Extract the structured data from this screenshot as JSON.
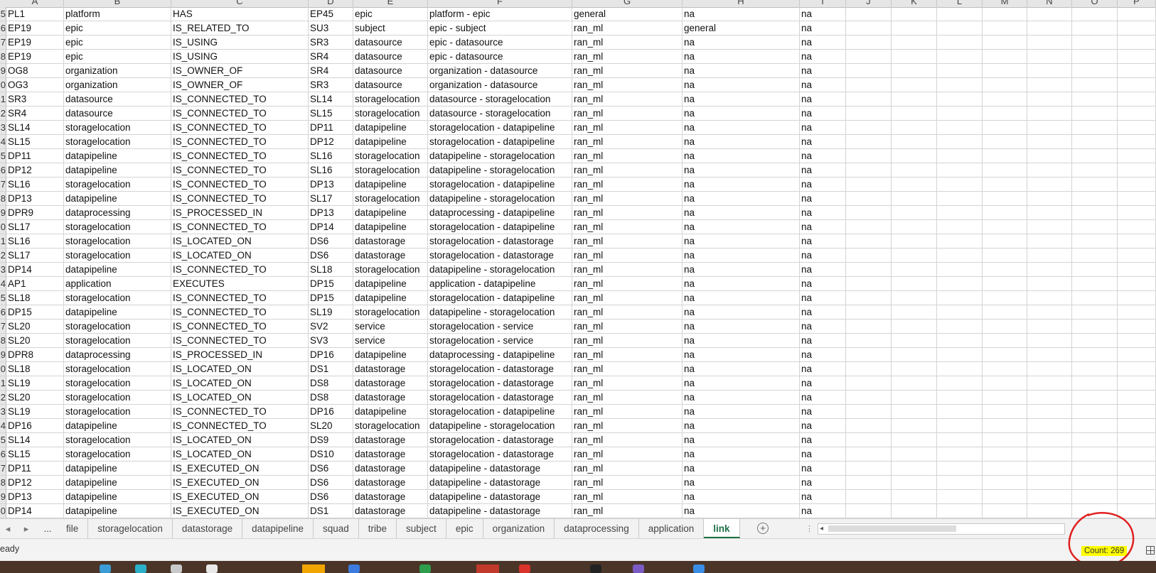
{
  "columns": [
    "A",
    "B",
    "C",
    "D",
    "E",
    "F",
    "G",
    "H",
    "I",
    "J",
    "K",
    "L",
    "M",
    "N",
    "O",
    "P"
  ],
  "row_number_labels": [
    "5",
    "6",
    "7",
    "8",
    "9",
    "0",
    "1",
    "2",
    "3",
    "4",
    "5",
    "6",
    "7",
    "8",
    "9",
    "0",
    "1",
    "2",
    "3",
    "4",
    "5",
    "6",
    "7",
    "8",
    "9",
    "0",
    "1",
    "2",
    "3",
    "4",
    "5",
    "6",
    "7",
    "8",
    "9",
    "0"
  ],
  "rows": [
    [
      "PL1",
      "platform",
      "HAS",
      "EP45",
      "epic",
      "platform - epic",
      "general",
      "na",
      "na"
    ],
    [
      "EP19",
      "epic",
      "IS_RELATED_TO",
      "SU3",
      "subject",
      "epic - subject",
      "ran_ml",
      "general",
      "na"
    ],
    [
      "EP19",
      "epic",
      "IS_USING",
      "SR3",
      "datasource",
      "epic - datasource",
      "ran_ml",
      "na",
      "na"
    ],
    [
      "EP19",
      "epic",
      "IS_USING",
      "SR4",
      "datasource",
      "epic - datasource",
      "ran_ml",
      "na",
      "na"
    ],
    [
      "OG8",
      "organization",
      "IS_OWNER_OF",
      "SR4",
      "datasource",
      "organization - datasource",
      "ran_ml",
      "na",
      "na"
    ],
    [
      "OG3",
      "organization",
      "IS_OWNER_OF",
      "SR3",
      "datasource",
      "organization - datasource",
      "ran_ml",
      "na",
      "na"
    ],
    [
      "SR3",
      "datasource",
      "IS_CONNECTED_TO",
      "SL14",
      "storagelocation",
      "datasource - storagelocation",
      "ran_ml",
      "na",
      "na"
    ],
    [
      "SR4",
      "datasource",
      "IS_CONNECTED_TO",
      "SL15",
      "storagelocation",
      "datasource - storagelocation",
      "ran_ml",
      "na",
      "na"
    ],
    [
      "SL14",
      "storagelocation",
      "IS_CONNECTED_TO",
      "DP11",
      "datapipeline",
      "storagelocation - datapipeline",
      "ran_ml",
      "na",
      "na"
    ],
    [
      "SL15",
      "storagelocation",
      "IS_CONNECTED_TO",
      "DP12",
      "datapipeline",
      "storagelocation - datapipeline",
      "ran_ml",
      "na",
      "na"
    ],
    [
      "DP11",
      "datapipeline",
      "IS_CONNECTED_TO",
      "SL16",
      "storagelocation",
      "datapipeline - storagelocation",
      "ran_ml",
      "na",
      "na"
    ],
    [
      "DP12",
      "datapipeline",
      "IS_CONNECTED_TO",
      "SL16",
      "storagelocation",
      "datapipeline - storagelocation",
      "ran_ml",
      "na",
      "na"
    ],
    [
      "SL16",
      "storagelocation",
      "IS_CONNECTED_TO",
      "DP13",
      "datapipeline",
      "storagelocation - datapipeline",
      "ran_ml",
      "na",
      "na"
    ],
    [
      "DP13",
      "datapipeline",
      "IS_CONNECTED_TO",
      "SL17",
      "storagelocation",
      "datapipeline - storagelocation",
      "ran_ml",
      "na",
      "na"
    ],
    [
      "DPR9",
      "dataprocessing",
      "IS_PROCESSED_IN",
      "DP13",
      "datapipeline",
      "dataprocessing - datapipeline",
      "ran_ml",
      "na",
      "na"
    ],
    [
      "SL17",
      "storagelocation",
      "IS_CONNECTED_TO",
      "DP14",
      "datapipeline",
      "storagelocation - datapipeline",
      "ran_ml",
      "na",
      "na"
    ],
    [
      "SL16",
      "storagelocation",
      "IS_LOCATED_ON",
      "DS6",
      "datastorage",
      "storagelocation - datastorage",
      "ran_ml",
      "na",
      "na"
    ],
    [
      "SL17",
      "storagelocation",
      "IS_LOCATED_ON",
      "DS6",
      "datastorage",
      "storagelocation - datastorage",
      "ran_ml",
      "na",
      "na"
    ],
    [
      "DP14",
      "datapipeline",
      "IS_CONNECTED_TO",
      "SL18",
      "storagelocation",
      "datapipeline - storagelocation",
      "ran_ml",
      "na",
      "na"
    ],
    [
      "AP1",
      "application",
      "EXECUTES",
      "DP15",
      "datapipeline",
      "application - datapipeline",
      "ran_ml",
      "na",
      "na"
    ],
    [
      "SL18",
      "storagelocation",
      "IS_CONNECTED_TO",
      "DP15",
      "datapipeline",
      "storagelocation - datapipeline",
      "ran_ml",
      "na",
      "na"
    ],
    [
      "DP15",
      "datapipeline",
      "IS_CONNECTED_TO",
      "SL19",
      "storagelocation",
      "datapipeline - storagelocation",
      "ran_ml",
      "na",
      "na"
    ],
    [
      "SL20",
      "storagelocation",
      "IS_CONNECTED_TO",
      "SV2",
      "service",
      "storagelocation - service",
      "ran_ml",
      "na",
      "na"
    ],
    [
      "SL20",
      "storagelocation",
      "IS_CONNECTED_TO",
      "SV3",
      "service",
      "storagelocation - service",
      "ran_ml",
      "na",
      "na"
    ],
    [
      "DPR8",
      "dataprocessing",
      "IS_PROCESSED_IN",
      "DP16",
      "datapipeline",
      "dataprocessing - datapipeline",
      "ran_ml",
      "na",
      "na"
    ],
    [
      "SL18",
      "storagelocation",
      "IS_LOCATED_ON",
      "DS1",
      "datastorage",
      "storagelocation - datastorage",
      "ran_ml",
      "na",
      "na"
    ],
    [
      "SL19",
      "storagelocation",
      "IS_LOCATED_ON",
      "DS8",
      "datastorage",
      "storagelocation - datastorage",
      "ran_ml",
      "na",
      "na"
    ],
    [
      "SL20",
      "storagelocation",
      "IS_LOCATED_ON",
      "DS8",
      "datastorage",
      "storagelocation - datastorage",
      "ran_ml",
      "na",
      "na"
    ],
    [
      "SL19",
      "storagelocation",
      "IS_CONNECTED_TO",
      "DP16",
      "datapipeline",
      "storagelocation - datapipeline",
      "ran_ml",
      "na",
      "na"
    ],
    [
      "DP16",
      "datapipeline",
      "IS_CONNECTED_TO",
      "SL20",
      "storagelocation",
      "datapipeline - storagelocation",
      "ran_ml",
      "na",
      "na"
    ],
    [
      "SL14",
      "storagelocation",
      "IS_LOCATED_ON",
      "DS9",
      "datastorage",
      "storagelocation - datastorage",
      "ran_ml",
      "na",
      "na"
    ],
    [
      "SL15",
      "storagelocation",
      "IS_LOCATED_ON",
      "DS10",
      "datastorage",
      "storagelocation - datastorage",
      "ran_ml",
      "na",
      "na"
    ],
    [
      "DP11",
      "datapipeline",
      "IS_EXECUTED_ON",
      "DS6",
      "datastorage",
      "datapipeline - datastorage",
      "ran_ml",
      "na",
      "na"
    ],
    [
      "DP12",
      "datapipeline",
      "IS_EXECUTED_ON",
      "DS6",
      "datastorage",
      "datapipeline - datastorage",
      "ran_ml",
      "na",
      "na"
    ],
    [
      "DP13",
      "datapipeline",
      "IS_EXECUTED_ON",
      "DS6",
      "datastorage",
      "datapipeline - datastorage",
      "ran_ml",
      "na",
      "na"
    ],
    [
      "DP14",
      "datapipeline",
      "IS_EXECUTED_ON",
      "DS1",
      "datastorage",
      "datapipeline - datastorage",
      "ran_ml",
      "na",
      "na"
    ]
  ],
  "sheet_tabs": {
    "more_label": "...",
    "tabs": [
      "file",
      "storagelocation",
      "datastorage",
      "datapipeline",
      "squad",
      "tribe",
      "subject",
      "epic",
      "organization",
      "dataprocessing",
      "application",
      "link"
    ],
    "active": "link",
    "tab_separator": "⋮"
  },
  "status_bar": {
    "status": "eady",
    "count_label": "Count: 269"
  },
  "colors": {
    "active_tab": "#1e7145",
    "count_highlight": "#ffff00",
    "annotation": "#e02020"
  },
  "icons": [
    "prev-sheet-icon",
    "next-sheet-icon",
    "add-sheet-icon",
    "scroll-left-icon",
    "normal-view-icon"
  ]
}
